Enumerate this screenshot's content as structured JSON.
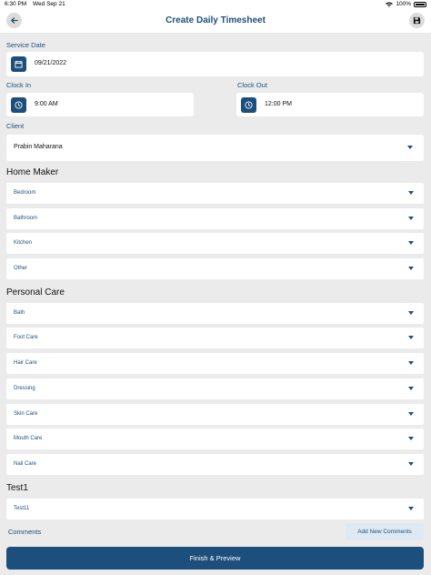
{
  "status_bar": {
    "time": "6:30 PM",
    "date": "Wed Sep 21",
    "battery": "100%"
  },
  "header": {
    "title": "Create Daily Timesheet"
  },
  "service_date": {
    "label": "Service Date",
    "value": "09/21/2022"
  },
  "clock_in": {
    "label": "Clock In",
    "value": "9:00 AM"
  },
  "clock_out": {
    "label": "Clock Out",
    "value": "12:00 PM"
  },
  "client": {
    "label": "Client",
    "value": "Prabin Maharana"
  },
  "home_maker": {
    "title": "Home Maker",
    "items": [
      "Bedroom",
      "Bathroom",
      "Kitchen",
      "Other"
    ]
  },
  "personal_care": {
    "title": "Personal Care",
    "items": [
      "Bath",
      "Foot Care",
      "Hair Care",
      "Dressing",
      "Skin Care",
      "Mouth Care",
      "Nail Care"
    ]
  },
  "test1": {
    "title": "Test1",
    "items": [
      "Test11"
    ]
  },
  "comments": {
    "label": "Comments",
    "add_label": "Add New Comments"
  },
  "finish": {
    "label": "Finish & Preview"
  },
  "colors": {
    "primary": "#1d4f7c",
    "background": "#ebebeb",
    "card": "#ffffff"
  }
}
